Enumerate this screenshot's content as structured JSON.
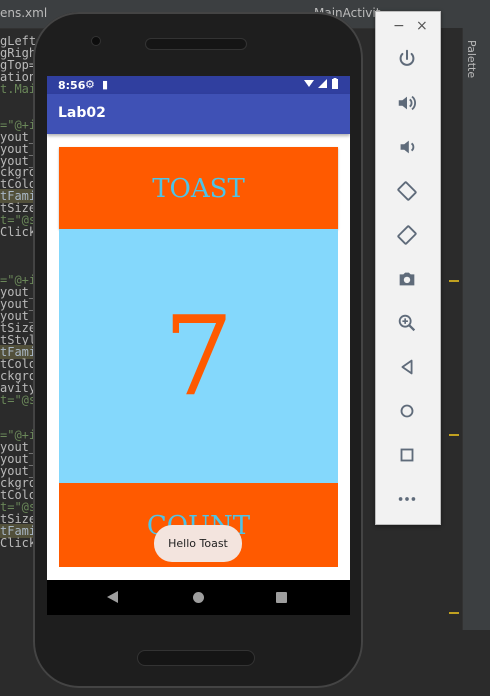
{
  "ide": {
    "tabs": [
      "ens.xml",
      "MainActivit"
    ],
    "palette_label": "Palette",
    "code_lines": [
      {
        "text": "gLeft=",
        "cls": "attr"
      },
      {
        "text": "gRight",
        "cls": "attr"
      },
      {
        "text": "gTop=",
        "cls": "attr"
      },
      {
        "text": "ation=",
        "cls": "attr"
      },
      {
        "text": "t.Main",
        "cls": "str"
      },
      {
        "text": "",
        "cls": ""
      },
      {
        "text": "",
        "cls": ""
      },
      {
        "text": "=\"@+id",
        "cls": "str"
      },
      {
        "text": "yout_w",
        "cls": "attr"
      },
      {
        "text": "yout_h",
        "cls": "attr"
      },
      {
        "text": "yout_w",
        "cls": "attr"
      },
      {
        "text": "ckgrou",
        "cls": "attr"
      },
      {
        "text": "tColo",
        "cls": "attr"
      },
      {
        "text": "tFami",
        "cls": "hl"
      },
      {
        "text": "tSize",
        "cls": "attr"
      },
      {
        "text": "t=\"@s",
        "cls": "str"
      },
      {
        "text": "Click=",
        "cls": "attr"
      },
      {
        "text": "",
        "cls": ""
      },
      {
        "text": "",
        "cls": ""
      },
      {
        "text": "",
        "cls": ""
      },
      {
        "text": "=\"@+id",
        "cls": "str"
      },
      {
        "text": "yout_w",
        "cls": "attr"
      },
      {
        "text": "yout_h",
        "cls": "attr"
      },
      {
        "text": "yout_w",
        "cls": "attr"
      },
      {
        "text": "tSize",
        "cls": "attr"
      },
      {
        "text": "tStyl",
        "cls": "attr"
      },
      {
        "text": "tFami",
        "cls": "hl"
      },
      {
        "text": "tColo",
        "cls": "attr"
      },
      {
        "text": "ckgrou",
        "cls": "attr"
      },
      {
        "text": "avity=",
        "cls": "attr"
      },
      {
        "text": "t=\"@s",
        "cls": "str"
      },
      {
        "text": "",
        "cls": ""
      },
      {
        "text": "",
        "cls": ""
      },
      {
        "text": "=\"@+id",
        "cls": "str"
      },
      {
        "text": "yout_w",
        "cls": "attr"
      },
      {
        "text": "yout_h",
        "cls": "attr"
      },
      {
        "text": "yout_w",
        "cls": "attr"
      },
      {
        "text": "ckgrou",
        "cls": "attr"
      },
      {
        "text": "tColo",
        "cls": "attr"
      },
      {
        "text": "t=\"@s",
        "cls": "str"
      },
      {
        "text": "tSize",
        "cls": "attr"
      },
      {
        "text": "tFami",
        "cls": "hl"
      },
      {
        "text": "Click=",
        "cls": "attr"
      }
    ]
  },
  "status_bar": {
    "time": "8:56"
  },
  "app": {
    "title": "Lab02",
    "toast_button_label": "TOAST",
    "count_value": "7",
    "count_button_label": "COUNT",
    "toast_message": "Hello Toast"
  },
  "emulator_toolbar": {
    "minimize": "−",
    "close": "×",
    "buttons": [
      "power-icon",
      "volume-up-icon",
      "volume-down-icon",
      "rotate-left-icon",
      "rotate-right-icon",
      "camera-icon",
      "zoom-icon",
      "back-icon",
      "home-icon",
      "overview-icon",
      "more-icon"
    ]
  },
  "colors": {
    "primary": "#3f51b5",
    "primary_dark": "#303f9f",
    "accent_orange": "#ff5a00",
    "light_blue": "#84d8fc",
    "text_cyan": "#4dc4e8"
  }
}
